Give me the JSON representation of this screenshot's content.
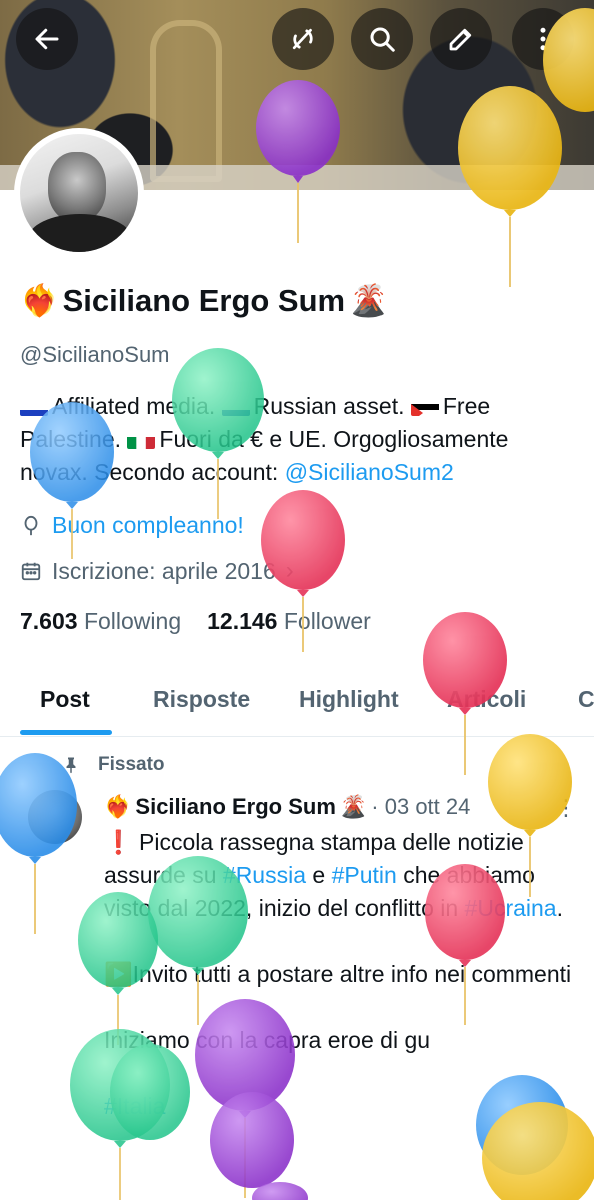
{
  "toolbar": {
    "back_icon": "arrow-left-icon",
    "grok_icon": "grok-slash-icon",
    "search_icon": "search-icon",
    "edit_icon": "pencil-icon",
    "more_icon": "more-vertical-icon"
  },
  "profile": {
    "name": "Siciliano Ergo Sum",
    "name_prefix_emoji": "❤️‍🔥",
    "name_suffix_emoji": "🌋",
    "handle": "@SicilianoSum",
    "bio": {
      "part1": "Affiliated media.",
      "part2": "Russian asset.",
      "part3": "Free Palestine.",
      "part4": "Fuori da € e UE. Orgogliosamente novax. Secondo account:",
      "link": "@SicilianoSum2"
    },
    "birthday": "Buon compleanno!",
    "joined": "Iscrizione: aprile 2016",
    "following_count": "7.603",
    "following_label": "Following",
    "followers_count": "12.146",
    "followers_label": "Follower"
  },
  "tabs": [
    "Post",
    "Risposte",
    "Highlight",
    "Articoli",
    "C"
  ],
  "pinned_post": {
    "pinned_label": "Fissato",
    "author": "Siciliano Ergo Sum",
    "date": "· 03 ott 24",
    "line1_prefix": "❗ Piccola rassegna stampa delle notizie assurde su ",
    "tag_russia": "#Russia",
    "and": " e ",
    "tag_putin": "#Putin",
    "line1_suffix": " che abbiamo visto dal 2022, inizio del conflitto in ",
    "tag_ucraina": "#Ucraina",
    "period": ".",
    "line2": "▶️Invito tutti a postare altre info nei commenti",
    "line3": "Iniziamo con la capra eroe di gu",
    "tag_italia": "#Italia"
  },
  "colors": {
    "accent": "#1d9bf0",
    "text": "#0f1419",
    "secondary": "#536471",
    "balloon_purple": "#9b3fd6",
    "balloon_yellow": "#f6c629",
    "balloon_green": "#33d79b",
    "balloon_blue": "#3aa0f5",
    "balloon_red": "#f24b6a"
  }
}
